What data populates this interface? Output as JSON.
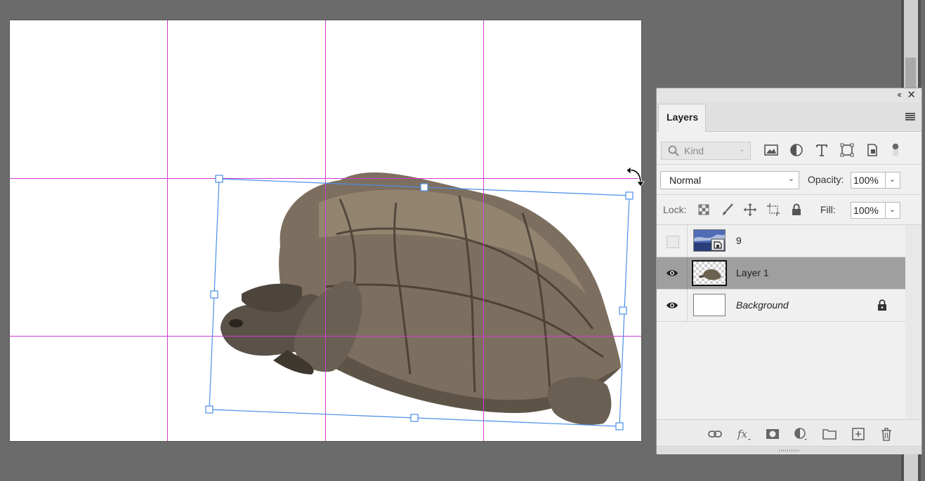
{
  "document": {
    "subject": "tortoise"
  },
  "layers_panel": {
    "collapse_glyph": "‹‹",
    "close_glyph": "✕",
    "tab_label": "Layers",
    "menu_icon": "panel-menu-icon",
    "filter": {
      "kind_placeholder": "Kind",
      "icons": [
        "image-filter-icon",
        "adjustment-filter-icon",
        "type-filter-icon",
        "shape-filter-icon",
        "smart-object-filter-icon",
        "filter-toggle-icon"
      ]
    },
    "blend_mode": "Normal",
    "opacity_label": "Opacity:",
    "opacity_value": "100%",
    "lock_label": "Lock:",
    "lock_icons": [
      "lock-transparent-pixels-icon",
      "lock-image-pixels-icon",
      "lock-position-icon",
      "lock-artboard-icon",
      "lock-all-icon"
    ],
    "fill_label": "Fill:",
    "fill_value": "100%",
    "layers": [
      {
        "name": "9",
        "visible": false,
        "selected": false,
        "italic": false,
        "locked": false,
        "thumbnail": "smart-object"
      },
      {
        "name": "Layer 1",
        "visible": true,
        "selected": true,
        "italic": false,
        "locked": false,
        "thumbnail": "tortoise"
      },
      {
        "name": "Background",
        "visible": true,
        "selected": false,
        "italic": true,
        "locked": true,
        "thumbnail": "white"
      }
    ],
    "bottom_icons": [
      "link-layers-icon",
      "layer-style-icon",
      "add-mask-icon",
      "new-adjustment-icon",
      "new-group-icon",
      "new-layer-icon",
      "delete-layer-icon"
    ]
  },
  "colors": {
    "workspace": "#6b6b6b",
    "guide": "#d23ad6",
    "transform_box": "#4a8ee8",
    "selected_layer": "#9f9f9f"
  }
}
